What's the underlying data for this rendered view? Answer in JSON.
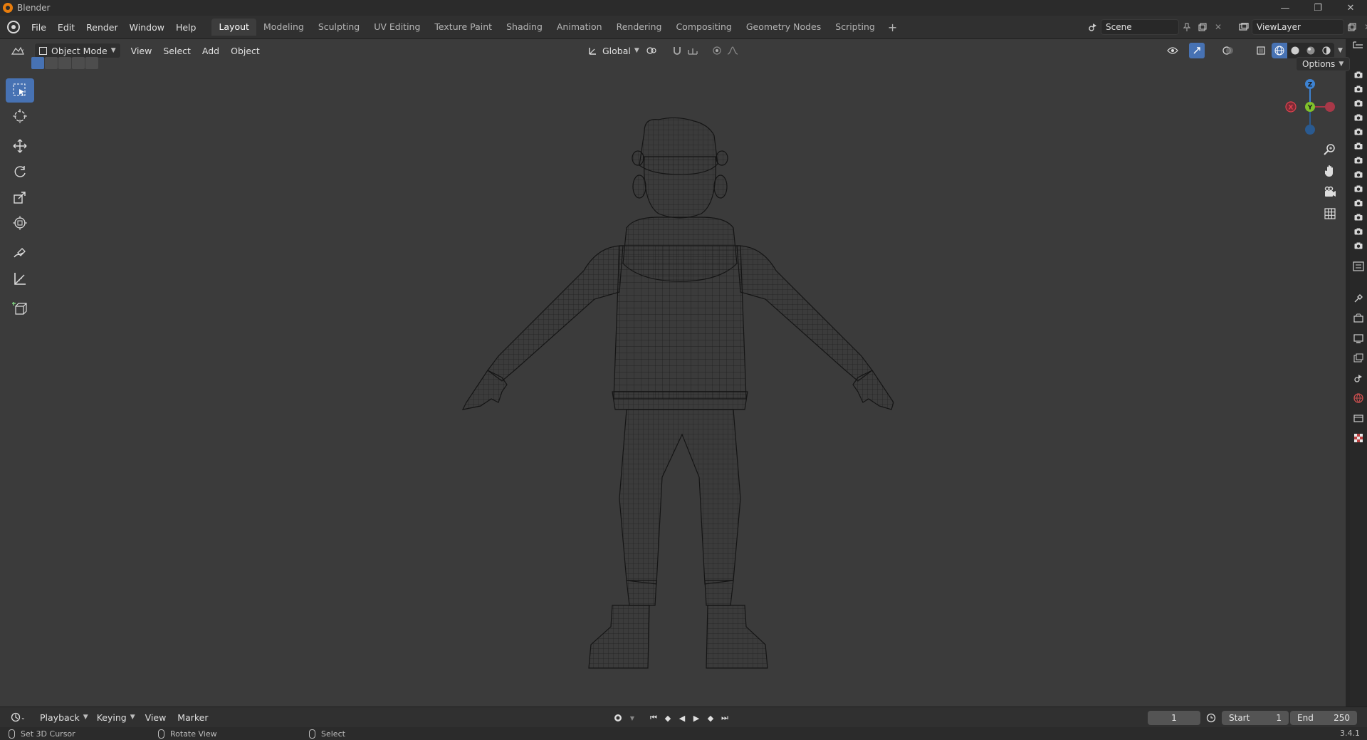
{
  "window": {
    "title": "Blender",
    "controls": [
      "—",
      "❐",
      "✕"
    ]
  },
  "menu": {
    "items": [
      "File",
      "Edit",
      "Render",
      "Window",
      "Help"
    ]
  },
  "workspaces": {
    "tabs": [
      "Layout",
      "Modeling",
      "Sculpting",
      "UV Editing",
      "Texture Paint",
      "Shading",
      "Animation",
      "Rendering",
      "Compositing",
      "Geometry Nodes",
      "Scripting"
    ],
    "active": "Layout"
  },
  "scene": {
    "name": "Scene",
    "view_layer": "ViewLayer"
  },
  "viewport_header": {
    "mode": "Object Mode",
    "menus": [
      "View",
      "Select",
      "Add",
      "Object"
    ],
    "transform_orientation": "Global",
    "options_label": "Options"
  },
  "gizmo": {
    "axes": {
      "x": "X",
      "y": "Y",
      "z": "Z"
    },
    "colors": {
      "x": "#e0424f",
      "y": "#80c12b",
      "z": "#3d82d1"
    }
  },
  "timeline": {
    "menus": [
      "Playback",
      "Keying",
      "View",
      "Marker"
    ],
    "current_frame": "1",
    "start_label": "Start",
    "start_value": "1",
    "end_label": "End",
    "end_value": "250"
  },
  "status_bar": {
    "items": [
      "Set 3D Cursor",
      "Rotate View",
      "Select"
    ],
    "version": "3.4.1"
  },
  "colors": {
    "accent": "#4772b3",
    "viewport_bg": "#3b3b3b",
    "wire": "#161616"
  }
}
